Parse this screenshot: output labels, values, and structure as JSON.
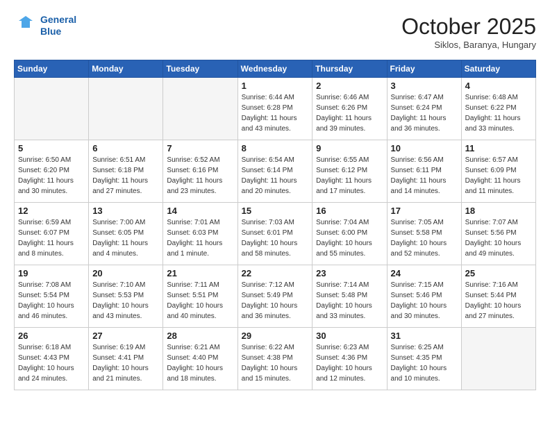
{
  "logo": {
    "line1": "General",
    "line2": "Blue"
  },
  "title": "October 2025",
  "subtitle": "Siklos, Baranya, Hungary",
  "days_of_week": [
    "Sunday",
    "Monday",
    "Tuesday",
    "Wednesday",
    "Thursday",
    "Friday",
    "Saturday"
  ],
  "weeks": [
    [
      {
        "day": "",
        "info": ""
      },
      {
        "day": "",
        "info": ""
      },
      {
        "day": "",
        "info": ""
      },
      {
        "day": "1",
        "info": "Sunrise: 6:44 AM\nSunset: 6:28 PM\nDaylight: 11 hours\nand 43 minutes."
      },
      {
        "day": "2",
        "info": "Sunrise: 6:46 AM\nSunset: 6:26 PM\nDaylight: 11 hours\nand 39 minutes."
      },
      {
        "day": "3",
        "info": "Sunrise: 6:47 AM\nSunset: 6:24 PM\nDaylight: 11 hours\nand 36 minutes."
      },
      {
        "day": "4",
        "info": "Sunrise: 6:48 AM\nSunset: 6:22 PM\nDaylight: 11 hours\nand 33 minutes."
      }
    ],
    [
      {
        "day": "5",
        "info": "Sunrise: 6:50 AM\nSunset: 6:20 PM\nDaylight: 11 hours\nand 30 minutes."
      },
      {
        "day": "6",
        "info": "Sunrise: 6:51 AM\nSunset: 6:18 PM\nDaylight: 11 hours\nand 27 minutes."
      },
      {
        "day": "7",
        "info": "Sunrise: 6:52 AM\nSunset: 6:16 PM\nDaylight: 11 hours\nand 23 minutes."
      },
      {
        "day": "8",
        "info": "Sunrise: 6:54 AM\nSunset: 6:14 PM\nDaylight: 11 hours\nand 20 minutes."
      },
      {
        "day": "9",
        "info": "Sunrise: 6:55 AM\nSunset: 6:12 PM\nDaylight: 11 hours\nand 17 minutes."
      },
      {
        "day": "10",
        "info": "Sunrise: 6:56 AM\nSunset: 6:11 PM\nDaylight: 11 hours\nand 14 minutes."
      },
      {
        "day": "11",
        "info": "Sunrise: 6:57 AM\nSunset: 6:09 PM\nDaylight: 11 hours\nand 11 minutes."
      }
    ],
    [
      {
        "day": "12",
        "info": "Sunrise: 6:59 AM\nSunset: 6:07 PM\nDaylight: 11 hours\nand 8 minutes."
      },
      {
        "day": "13",
        "info": "Sunrise: 7:00 AM\nSunset: 6:05 PM\nDaylight: 11 hours\nand 4 minutes."
      },
      {
        "day": "14",
        "info": "Sunrise: 7:01 AM\nSunset: 6:03 PM\nDaylight: 11 hours\nand 1 minute."
      },
      {
        "day": "15",
        "info": "Sunrise: 7:03 AM\nSunset: 6:01 PM\nDaylight: 10 hours\nand 58 minutes."
      },
      {
        "day": "16",
        "info": "Sunrise: 7:04 AM\nSunset: 6:00 PM\nDaylight: 10 hours\nand 55 minutes."
      },
      {
        "day": "17",
        "info": "Sunrise: 7:05 AM\nSunset: 5:58 PM\nDaylight: 10 hours\nand 52 minutes."
      },
      {
        "day": "18",
        "info": "Sunrise: 7:07 AM\nSunset: 5:56 PM\nDaylight: 10 hours\nand 49 minutes."
      }
    ],
    [
      {
        "day": "19",
        "info": "Sunrise: 7:08 AM\nSunset: 5:54 PM\nDaylight: 10 hours\nand 46 minutes."
      },
      {
        "day": "20",
        "info": "Sunrise: 7:10 AM\nSunset: 5:53 PM\nDaylight: 10 hours\nand 43 minutes."
      },
      {
        "day": "21",
        "info": "Sunrise: 7:11 AM\nSunset: 5:51 PM\nDaylight: 10 hours\nand 40 minutes."
      },
      {
        "day": "22",
        "info": "Sunrise: 7:12 AM\nSunset: 5:49 PM\nDaylight: 10 hours\nand 36 minutes."
      },
      {
        "day": "23",
        "info": "Sunrise: 7:14 AM\nSunset: 5:48 PM\nDaylight: 10 hours\nand 33 minutes."
      },
      {
        "day": "24",
        "info": "Sunrise: 7:15 AM\nSunset: 5:46 PM\nDaylight: 10 hours\nand 30 minutes."
      },
      {
        "day": "25",
        "info": "Sunrise: 7:16 AM\nSunset: 5:44 PM\nDaylight: 10 hours\nand 27 minutes."
      }
    ],
    [
      {
        "day": "26",
        "info": "Sunrise: 6:18 AM\nSunset: 4:43 PM\nDaylight: 10 hours\nand 24 minutes."
      },
      {
        "day": "27",
        "info": "Sunrise: 6:19 AM\nSunset: 4:41 PM\nDaylight: 10 hours\nand 21 minutes."
      },
      {
        "day": "28",
        "info": "Sunrise: 6:21 AM\nSunset: 4:40 PM\nDaylight: 10 hours\nand 18 minutes."
      },
      {
        "day": "29",
        "info": "Sunrise: 6:22 AM\nSunset: 4:38 PM\nDaylight: 10 hours\nand 15 minutes."
      },
      {
        "day": "30",
        "info": "Sunrise: 6:23 AM\nSunset: 4:36 PM\nDaylight: 10 hours\nand 12 minutes."
      },
      {
        "day": "31",
        "info": "Sunrise: 6:25 AM\nSunset: 4:35 PM\nDaylight: 10 hours\nand 10 minutes."
      },
      {
        "day": "",
        "info": ""
      }
    ]
  ]
}
